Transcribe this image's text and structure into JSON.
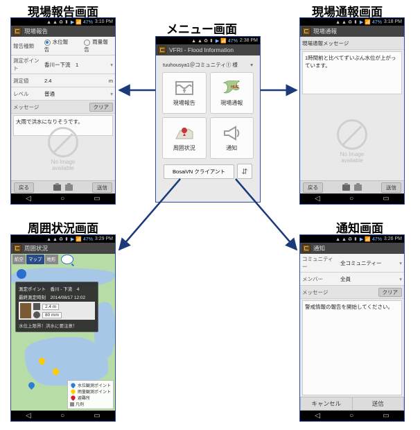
{
  "labels": {
    "report_title": "現場報告画面",
    "menu_title": "メニュー画面",
    "alert_title": "現場通報画面",
    "surround_title": "周囲状況画面",
    "notice_title": "通知画面"
  },
  "status": {
    "icons": "▲ ▲ ♻ ⬍",
    "signal": "▶ 📶 47%",
    "time1": "3:10 PM",
    "time2": "2:38 PM",
    "time3": "3:18 PM",
    "time4": "3:29 PM",
    "time5": "3:26 PM"
  },
  "navbar": {
    "back": "◁",
    "home": "○",
    "recent": "▭"
  },
  "noimg": "No Image\navailable",
  "report": {
    "title": "現場報告",
    "type_lbl": "報告種類",
    "type_opt1": "水位報告",
    "type_opt2": "雨量報告",
    "point_lbl": "測定ポイント",
    "point_val": "香川ー下流　1",
    "meas_lbl": "測定値",
    "meas_val": "2.4",
    "meas_unit": "m",
    "level_lbl": "レベル",
    "level_val": "普通",
    "msg_lbl": "メッセージ",
    "clear": "クリア",
    "msg": "大雨で洪水になりそうです。",
    "back_btn": "戻る",
    "send_btn": "送信"
  },
  "menu": {
    "title": "VFRI - Flood Information",
    "user": "tuuhousya1＠コミュニティ① 様",
    "tile1": "現場報告",
    "tile2": "現場通報",
    "tile3": "周囲状況",
    "tile4": "通知",
    "footer": "BosaiVN クライアント",
    "cfg": "⇵"
  },
  "alert": {
    "title": "現場通報",
    "header": "現場通報メッセージ",
    "msg": "1時間前と比べてずいぶん水位が上がっています。",
    "back_btn": "戻る",
    "send_btn": "送信"
  },
  "surround": {
    "title": "周囲状況",
    "tab1": "航空",
    "tab2": "マップ",
    "tab3": "地形",
    "popup_point": "測定ポイント　香川 - 下流　4",
    "popup_date": "最終測定時刻　2014/08/17 12:02",
    "popup_v1": "2.4  m",
    "popup_v2": "80   mm",
    "popup_note": "水位上限界！洪水に要注意！",
    "legend1": "水位観測ポイント",
    "legend2": "雨量観測ポイント",
    "legend3": "避難所",
    "legend4": "凡例"
  },
  "notice": {
    "title": "通知",
    "comm_lbl": "コミュニティー",
    "comm_val": "全コミュニティー",
    "member_lbl": "メンバー",
    "member_val": "全員",
    "msg_lbl": "メッセージ",
    "clear": "クリア",
    "msg": "警戒情報の報告を開始してください。",
    "cancel": "キャンセル",
    "send": "送信"
  }
}
